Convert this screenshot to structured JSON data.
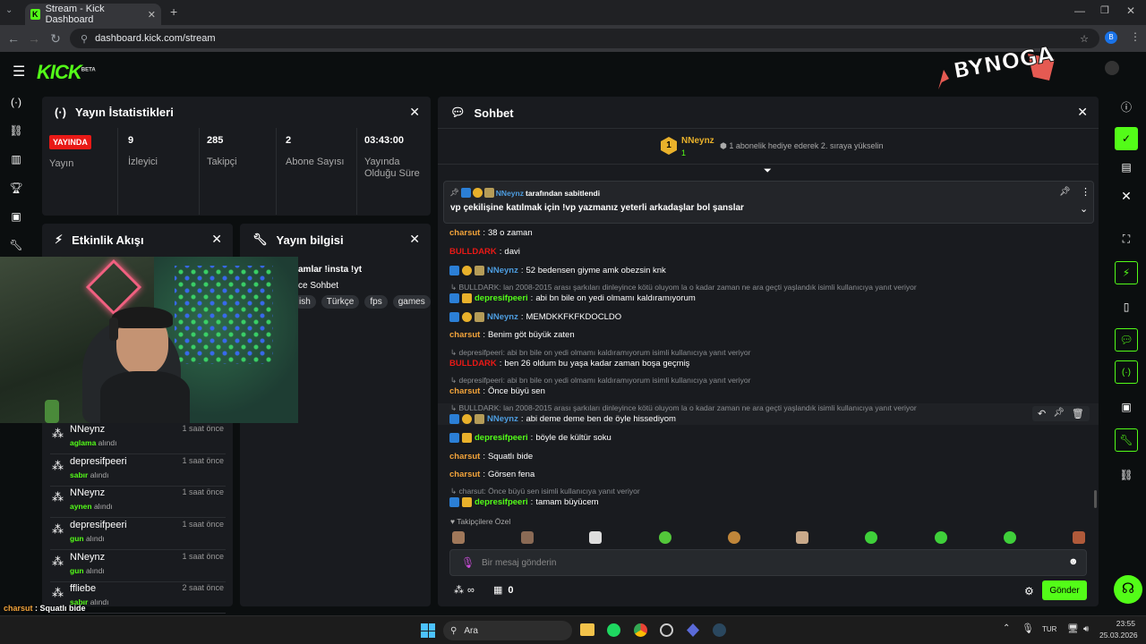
{
  "browser": {
    "tab_title": "Stream - Kick Dashboard",
    "url": "dashboard.kick.com/stream",
    "profile_initial": "B"
  },
  "brand": {
    "logo": "KICK",
    "logo_sup": "BETA",
    "overlay_logo": "BYNOGA"
  },
  "stats": {
    "title": "Yayın İstatistikleri",
    "live_badge": "YAYINDA",
    "cells": [
      {
        "value": "",
        "label": "Yayın"
      },
      {
        "value": "9",
        "label": "İzleyici"
      },
      {
        "value": "285",
        "label": "Takipçi"
      },
      {
        "value": "2",
        "label": "Abone Sayısı"
      },
      {
        "value": "03:43:00",
        "label": "Yayında Olduğu Süre"
      }
    ]
  },
  "activity": {
    "title": "Etkinlik Akışı",
    "items": [
      {
        "name": "NNeynz",
        "time": "1 saat önce",
        "item": "aglama",
        "suffix": "alındı"
      },
      {
        "name": "depresifpeeri",
        "time": "1 saat önce",
        "item": "sabır",
        "suffix": "alındı"
      },
      {
        "name": "NNeynz",
        "time": "1 saat önce",
        "item": "aynen",
        "suffix": "alındı"
      },
      {
        "name": "depresifpeeri",
        "time": "1 saat önce",
        "item": "gun",
        "suffix": "alındı"
      },
      {
        "name": "NNeynz",
        "time": "1 saat önce",
        "item": "gun",
        "suffix": "alındı"
      },
      {
        "name": "ffliebe",
        "time": "2 saat önce",
        "item": "sabır",
        "suffix": "alındı"
      }
    ]
  },
  "stream_info": {
    "title": "Yayın bilgisi",
    "stream_title": "amlar !insta !yt",
    "category": "ce Sohbet",
    "tags": [
      "ish",
      "Türkçe",
      "fps",
      "games"
    ]
  },
  "chat": {
    "title": "Sohbet",
    "top_gifter": {
      "rank": "1",
      "name": "NNeynz",
      "count": "1"
    },
    "gift_prompt": "1 abonelik hediye ederek 2. sıraya yükselin",
    "pinned": {
      "by": "NNeynz",
      "by_suffix": "tarafından sabitlendi",
      "text": "vp çekilişine katılmak için !vp yazmanız yeterli arkadaşlar bol şanslar"
    },
    "messages": [
      {
        "user": "charsut",
        "color": "orange",
        "text": "38 o zaman"
      },
      {
        "user": "BULLDARK",
        "color": "red",
        "text": "davi"
      },
      {
        "user": "NNeynz",
        "color": "blue",
        "text": "52 bedensen giyme amk obezsin knk"
      },
      {
        "user": "depresifpeeri",
        "color": "green",
        "text": "abi bn bile on yedi olmamı kaldıramıyorum",
        "reply": "BULLDARK: lan 2008-2015 arası şarkıları dinleyince kötü oluyom la o kadar zaman ne ara geçti yaşlandık isimli kullanıcıya yanıt veriyor"
      },
      {
        "user": "NNeynz",
        "color": "blue",
        "text": "MEMDKKFKFKDOCLDO"
      },
      {
        "user": "charsut",
        "color": "orange",
        "text": "Benim göt büyük zaten"
      },
      {
        "user": "BULLDARK",
        "color": "red",
        "text": "ben 26 oldum bu yaşa kadar zaman boşa geçmiş",
        "reply": "depresifpeeri: abi bn bile on yedi olmamı kaldıramıyorum isimli kullanıcıya yanıt veriyor"
      },
      {
        "user": "charsut",
        "color": "orange",
        "text": "Önce büyü sen",
        "reply": "depresifpeeri: abi bn bile on yedi olmamı kaldıramıyorum isimli kullanıcıya yanıt veriyor"
      },
      {
        "user": "NNeynz",
        "color": "blue",
        "text": "abi deme deme ben de öyle hissediyom",
        "reply": "BULLDARK: lan 2008-2015 arası şarkıları dinleyince kötü oluyom la o kadar zaman ne ara geçti yaşlandık isimli kullanıcıya yanıt veriyor"
      },
      {
        "user": "depresifpeeri",
        "color": "green",
        "text": "böyle de kültür soku"
      },
      {
        "user": "charsut",
        "color": "orange",
        "text": "Squatlı bide"
      },
      {
        "user": "charsut",
        "color": "orange",
        "text": "Görsen fena"
      },
      {
        "user": "depresifpeeri",
        "color": "green",
        "text": "tamam büyücem",
        "reply": "charsut: Önce büyü sen isimli kullanıcıya yanıt veriyor"
      }
    ],
    "followers_only_label": "Takipçilere Özel",
    "input_placeholder": "Bir mesaj gönderin",
    "infinity": "∞",
    "points": "0",
    "send_label": "Gönder"
  },
  "overlay_chat": [
    {
      "user": "charsut",
      "text": "Squatlı bide"
    },
    {
      "user": "charsut",
      "text": "Görsen fena"
    },
    {
      "user": "depresifpeeri",
      "text": "tamam büyücem"
    }
  ],
  "taskbar": {
    "search_label": "Ara",
    "lang": "TUR",
    "time": "23:55",
    "date": "25.03.2026"
  },
  "colors": {
    "accent": "#53fc18",
    "live": "#e91916",
    "panel": "#191b1f",
    "bg": "#0b0e0f"
  }
}
